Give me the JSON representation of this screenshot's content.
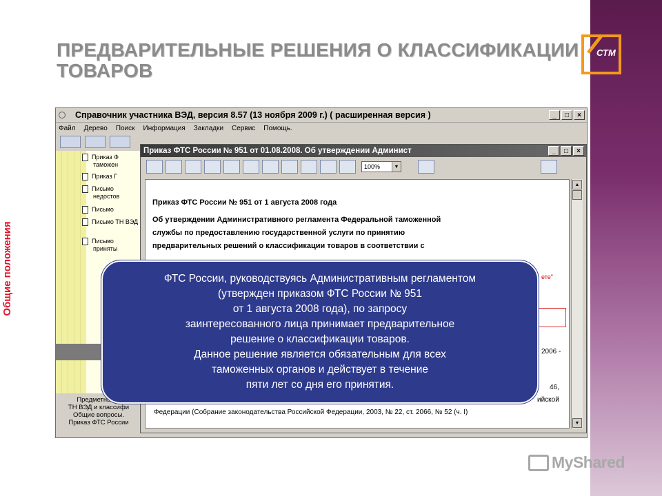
{
  "slide": {
    "title": "ПРЕДВАРИТЕЛЬНЫЕ РЕШЕНИЯ О КЛАССИФИКАЦИИ ТОВАРОВ",
    "side_label": "Общие положения",
    "logo_text": "СТМ",
    "accent_color": "#f39a1e",
    "side_label_color": "#e0142e",
    "watermark": "MyShared"
  },
  "app": {
    "title": "Справочник участника ВЭД, версия 8.57 (13 ноября 2009 г.)  ( расширенная версия )",
    "window_buttons": [
      "_",
      "□",
      "×"
    ],
    "menu": [
      "Файл",
      "Дерево",
      "Поиск",
      "Информация",
      "Закладки",
      "Сервис",
      "Помощь."
    ]
  },
  "tree": {
    "items": [
      "Приказ Ф таможен",
      "Приказ Г",
      "Письмо недостов",
      "Письмо",
      "Письмо ТН ВЭД",
      "Письмо приняты"
    ]
  },
  "bottom_panel": {
    "lines": [
      "Предметный у",
      "ТН ВЭД и классифи",
      "Общие вопросы.",
      "Приказ ФТС России"
    ]
  },
  "child_window": {
    "title": "Приказ ФТС России № 951 от 01.08.2008. Об утверждении Админист",
    "zoom_value": "100%",
    "doc_heading": "Приказ ФТС России № 951 от 1 августа 2008 года",
    "doc_lines": [
      "Об утверждении Административного регламента Федеральной таможенной",
      "службы по предоставлению государственной услуги по принятию",
      "предварительных решений о классификации товаров в соответствии с"
    ],
    "red_fragment": "ете\"",
    "right_fragments": [
      "2006 -",
      "46,",
      "ийской"
    ],
    "bottom_fragment": "Федерации (Собрание законодательства Российской Федерации, 2003, № 22, ст. 2066, № 52 (ч. I)"
  },
  "overlay": {
    "lines": [
      "ФТС России, руководствуясь Административным регламентом",
      "(утвержден приказом ФТС России № 951",
      "от 1 августа 2008 года), по запросу",
      "заинтересованного лица принимает предварительное",
      "решение о классификации товаров.",
      "Данное решение является обязательным для всех",
      "таможенных органов и действует в течение",
      "пяти лет со дня его принятия."
    ],
    "color": "#2e3a8c"
  }
}
